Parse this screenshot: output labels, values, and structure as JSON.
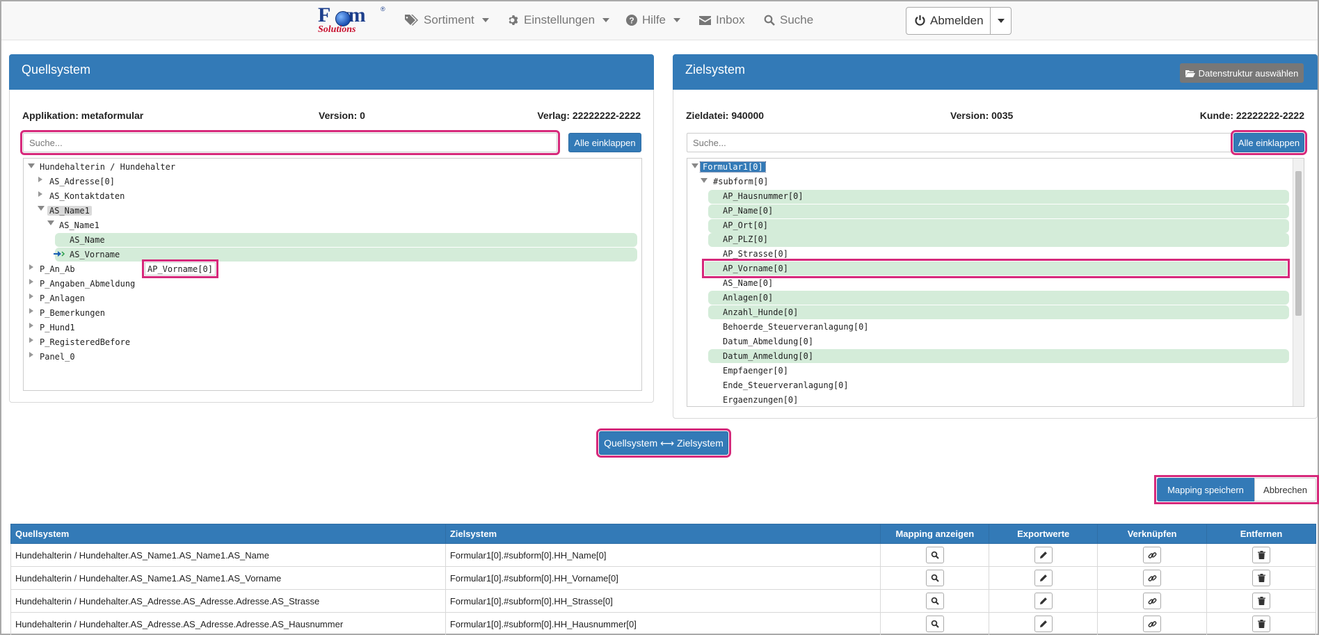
{
  "nav": {
    "logo_text": "Form Solutions",
    "items": [
      {
        "label": "Sortiment",
        "icon": "tags-icon",
        "dropdown": true
      },
      {
        "label": "Einstellungen",
        "icon": "gear-icon",
        "dropdown": true
      },
      {
        "label": "Hilfe",
        "icon": "question-circle-icon",
        "dropdown": true
      },
      {
        "label": "Inbox",
        "icon": "envelope-icon",
        "dropdown": false
      },
      {
        "label": "Suche",
        "icon": "search-icon",
        "dropdown": false
      }
    ],
    "logout_label": "Abmelden"
  },
  "source": {
    "title": "Quellsystem",
    "app": "Applikation: metaformular",
    "version": "Version: 0",
    "publisher": "Verlag: 22222222-2222",
    "search_placeholder": "Suche...",
    "collapse_label": "Alle einklappen",
    "drag_tooltip": "AP_Vorname[0]",
    "tree": [
      "Hundehalterin / Hundehalter",
      "AS_Adresse[0]",
      "AS_Kontaktdaten",
      "AS_Name1",
      "AS_Name1",
      "AS_Name",
      "AS_Vorname",
      "P_An_Ab",
      "P_Angaben_Abmeldung",
      "P_Anlagen",
      "P_Bemerkungen",
      "P_Hund1",
      "P_RegisteredBefore",
      "Panel_0"
    ]
  },
  "target": {
    "title": "Zielsystem",
    "select_structure_label": "Datenstruktur auswählen",
    "file": "Zieldatei: 940000",
    "version": "Version: 0035",
    "customer": "Kunde: 22222222-2222",
    "search_placeholder": "Suche...",
    "collapse_label": "Alle einklappen",
    "tree": [
      "Formular1[0]",
      "#subform[0]",
      "AP_Hausnummer[0]",
      "AP_Name[0]",
      "AP_Ort[0]",
      "AP_PLZ[0]",
      "AP_Strasse[0]",
      "AP_Vorname[0]",
      "AS_Name[0]",
      "Anlagen[0]",
      "Anzahl_Hunde[0]",
      "Behoerde_Steuerveranlagung[0]",
      "Datum_Abmeldung[0]",
      "Datum_Anmeldung[0]",
      "Empfaenger[0]",
      "Ende_Steuerveranlagung[0]",
      "Ergaenzungen[0]"
    ]
  },
  "map_button_label": "Quellsystem ⟷ Zielsystem",
  "save_mapping_label": "Mapping speichern",
  "cancel_label": "Abbrechen",
  "table": {
    "headers": [
      "Quellsystem",
      "Zielsystem",
      "Mapping anzeigen",
      "Exportwerte",
      "Verknüpfen",
      "Entfernen"
    ],
    "rows": [
      {
        "source": "Hundehalterin / Hundehalter.AS_Name1.AS_Name1.AS_Name",
        "target": "Formular1[0].#subform[0].HH_Name[0]"
      },
      {
        "source": "Hundehalterin / Hundehalter.AS_Name1.AS_Name1.AS_Vorname",
        "target": "Formular1[0].#subform[0].HH_Vorname[0]"
      },
      {
        "source": "Hundehalterin / Hundehalter.AS_Adresse.AS_Adresse.Adresse.AS_Strasse",
        "target": "Formular1[0].#subform[0].HH_Strasse[0]"
      },
      {
        "source": "Hundehalterin / Hundehalter.AS_Adresse.AS_Adresse.Adresse.AS_Hausnummer",
        "target": "Formular1[0].#subform[0].HH_Hausnummer[0]"
      }
    ]
  },
  "colors": {
    "primary": "#337ab7",
    "highlight": "#d6297b",
    "mapped": "#d4ecd9"
  }
}
